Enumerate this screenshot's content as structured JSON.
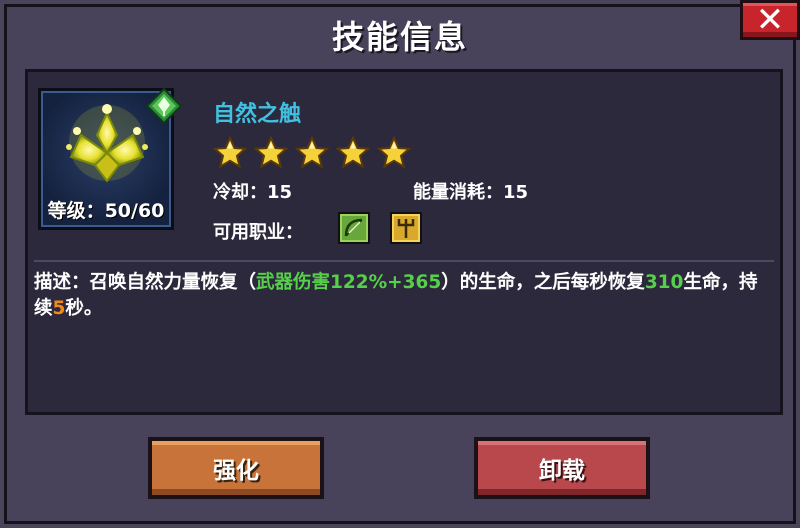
{
  "dialog": {
    "title": "技能信息",
    "close_label": "✕"
  },
  "skill": {
    "name": "自然之触",
    "level_text": "等级：50/60",
    "star_count": 5,
    "icon": "golden-flower-icon",
    "element_icon": "nature-leaf-icon",
    "cooldown": "冷却：15",
    "energy_cost": "能量消耗：15",
    "classes_label": "可用职业：",
    "classes": [
      {
        "name": "ranger",
        "icon": "bow-icon"
      },
      {
        "name": "priest",
        "icon": "trident-icon"
      }
    ],
    "description": {
      "prefix": "描述：召唤自然力量恢复（",
      "formula": "武器伤害122%+365",
      "middle": "）的生命，之后每秒恢复",
      "heal_value": "310",
      "after_heal": "生命，持续",
      "duration": "5",
      "suffix": "秒。"
    }
  },
  "buttons": {
    "upgrade": "强化",
    "unequip": "卸载"
  },
  "colors": {
    "skill_name": "#41c0e0",
    "highlight_green": "#56d04a",
    "highlight_orange": "#f08a1a",
    "upgrade_button": "#c8733a",
    "unequip_button": "#b8484c",
    "close_button": "#c8242c"
  }
}
